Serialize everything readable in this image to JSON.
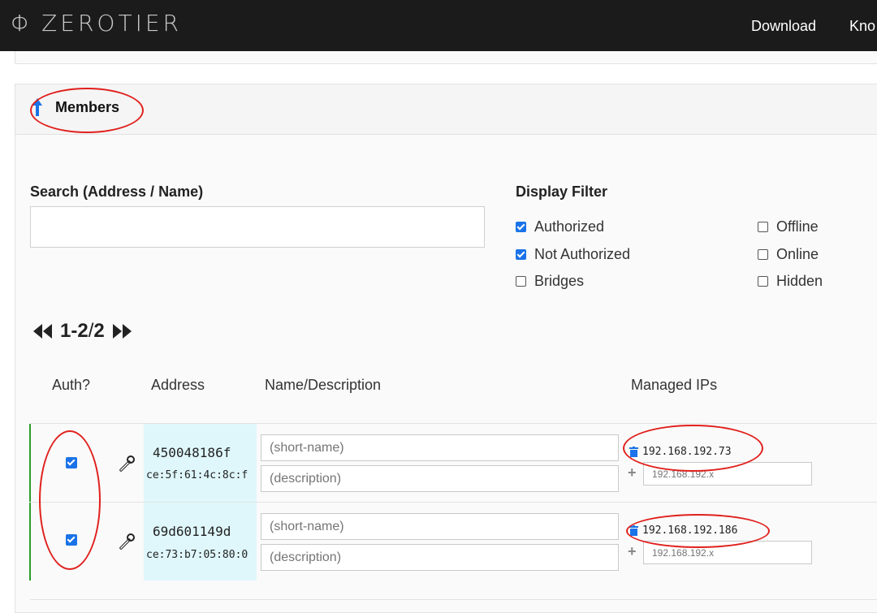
{
  "header": {
    "logo_symbol": "Φ",
    "logo_text": "ZEROTIER",
    "nav": [
      "Download",
      "Kno"
    ]
  },
  "members": {
    "title": "Members",
    "search_label": "Search (Address / Name)",
    "search_value": "",
    "filter_label": "Display Filter",
    "filters": [
      {
        "label": "Authorized",
        "checked": true
      },
      {
        "label": "Not Authorized",
        "checked": true
      },
      {
        "label": "Bridges",
        "checked": false
      },
      {
        "label": "Offline",
        "checked": false
      },
      {
        "label": "Online",
        "checked": false
      },
      {
        "label": "Hidden",
        "checked": false
      }
    ],
    "pager": {
      "range": "1-2",
      "separator": " / ",
      "total": "2"
    },
    "columns": [
      "Auth?",
      "Address",
      "Name/Description",
      "Managed IPs"
    ],
    "rows": [
      {
        "authorized": true,
        "address": "450048186f",
        "mac": "ce:5f:61:4c:8c:f",
        "name_placeholder": "(short-name)",
        "description_placeholder": "(description)",
        "ip": "192.168.192.73",
        "ip_placeholder": "192.168.192.x"
      },
      {
        "authorized": true,
        "address": "69d601149d",
        "mac": "ce:73:b7:05:80:0",
        "name_placeholder": "(short-name)",
        "description_placeholder": "(description)",
        "ip": "192.168.192.186",
        "ip_placeholder": "192.168.192.x"
      }
    ]
  },
  "colors": {
    "topbar": "#1b1b1b",
    "accent": "#1a73e8",
    "row_border": "#2a9d2a",
    "address_bg": "#dff7fb",
    "annotation": "#e0201c"
  },
  "icons": [
    "arrow-up-icon",
    "first-page-icon",
    "last-page-icon",
    "wrench-icon",
    "trash-icon",
    "plus-icon"
  ]
}
